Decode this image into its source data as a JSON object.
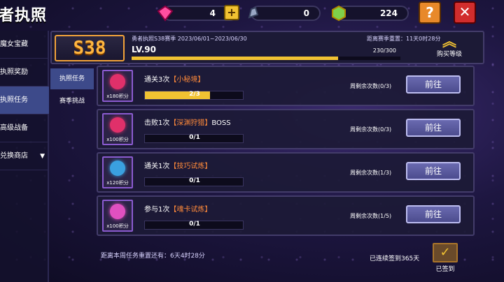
{
  "header": {
    "title": "者执照",
    "currencies": [
      {
        "name": "gem",
        "value": "4",
        "icon": "pink-gem-icon"
      },
      {
        "name": "stone",
        "value": "0",
        "icon": "silver-stone-icon"
      },
      {
        "name": "coin",
        "value": "224",
        "icon": "green-crystal-icon"
      }
    ],
    "plus_label": "+",
    "help_label": "?",
    "close_label": "✕"
  },
  "sidebar": {
    "items": [
      {
        "label": "魔女宝藏"
      },
      {
        "label": "执照奖励"
      },
      {
        "label": "执照任务"
      },
      {
        "label": "高级战备"
      },
      {
        "label": "兑换商店"
      }
    ]
  },
  "season": {
    "badge": "S38",
    "name": "勇者执照S38赛季 2023/06/01~2023/06/30",
    "reset_text": "距离赛季重置：11天0时28分",
    "level": "LV.90",
    "xp": "230/300",
    "xp_fraction": 0.767,
    "buy_label": "购买等级"
  },
  "subtabs": [
    {
      "label": "执照任务"
    },
    {
      "label": "赛季挑战"
    }
  ],
  "tasks": [
    {
      "title_prefix": "通关3次",
      "title_highlight": "【小秘境】",
      "title_suffix": "",
      "reward": "x180积分",
      "progress": "2/3",
      "progress_fraction": 0.667,
      "remain": "周剩余次数(0/3)",
      "button": "前往",
      "icon": "demon-face-icon",
      "icon_color": "#e0306a"
    },
    {
      "title_prefix": "击败1次",
      "title_highlight": "【深渊狩猎】",
      "title_suffix": "BOSS",
      "reward": "x100积分",
      "progress": "0/1",
      "progress_fraction": 0,
      "remain": "周剩余次数(0/3)",
      "button": "前往",
      "icon": "demon-face-icon",
      "icon_color": "#e0306a"
    },
    {
      "title_prefix": "通关1次",
      "title_highlight": "【技巧试炼】",
      "title_suffix": "",
      "reward": "x120积分",
      "progress": "0/1",
      "progress_fraction": 0,
      "remain": "周剩余次数(1/3)",
      "button": "前往",
      "icon": "blue-orb-icon",
      "icon_color": "#3aa0e0"
    },
    {
      "title_prefix": "参与1次",
      "title_highlight": "【魂卡试炼】",
      "title_suffix": "",
      "reward": "x100积分",
      "progress": "0/1",
      "progress_fraction": 0,
      "remain": "周剩余次数(1/5)",
      "button": "前往",
      "icon": "soul-card-icon",
      "icon_color": "#e050c0"
    }
  ],
  "footer": {
    "reset_text": "距离本周任务重置还有：6天4时28分",
    "signin_text": "已连续签到365天",
    "signin_label": "已签到"
  }
}
